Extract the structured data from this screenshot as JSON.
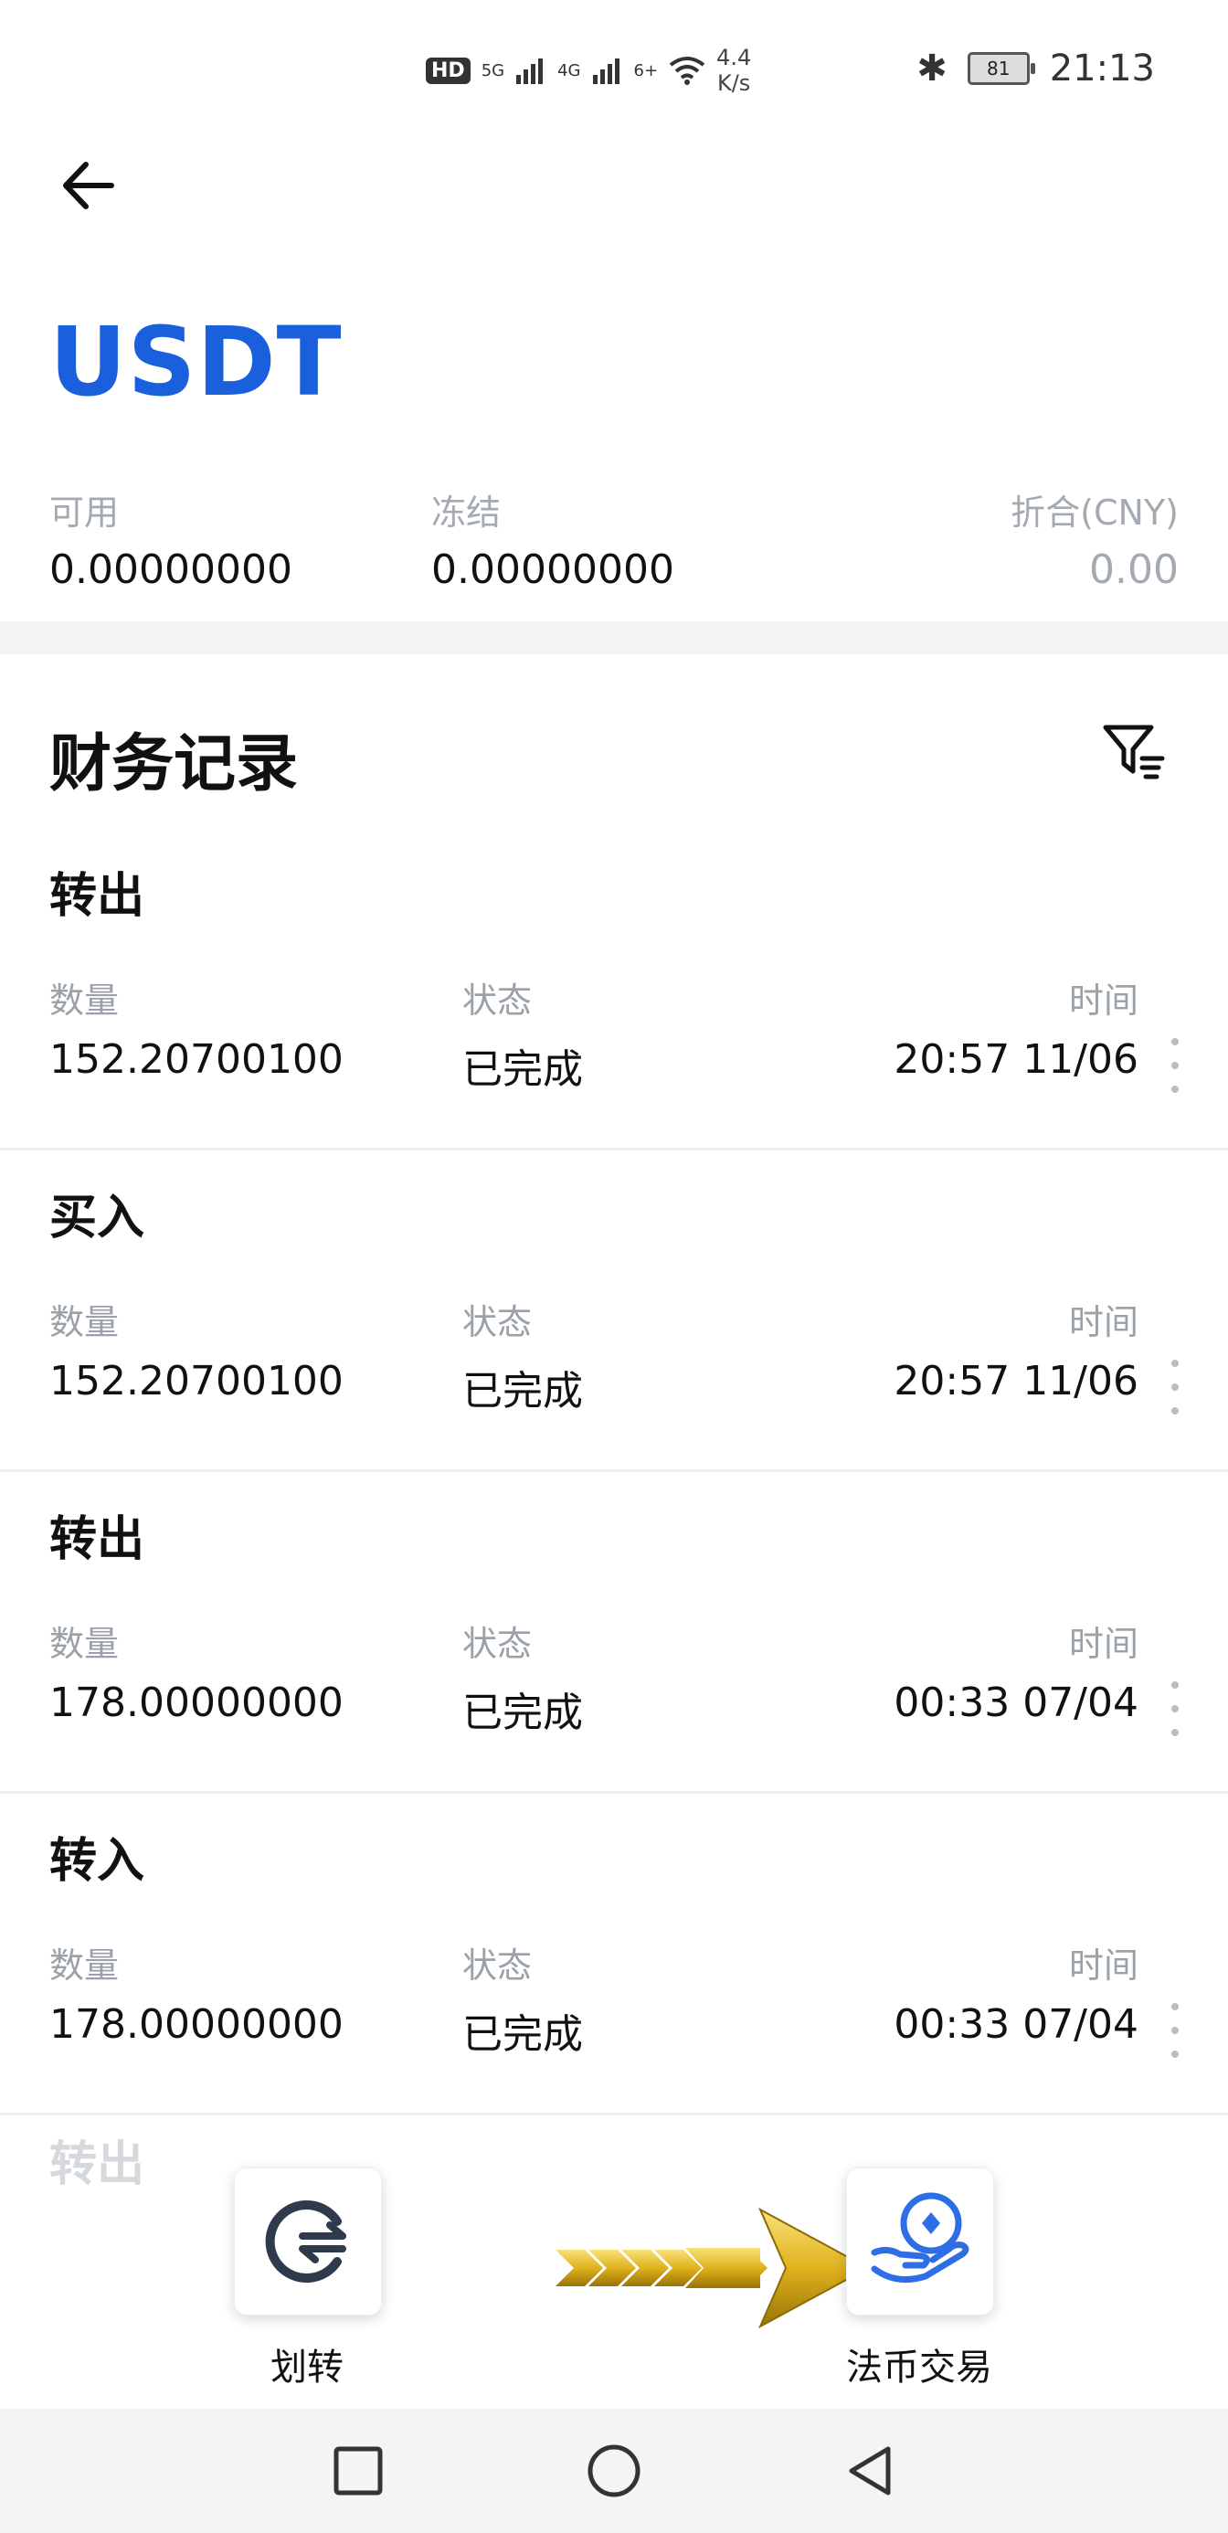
{
  "status_bar": {
    "hd": "HD",
    "sim1": "5G",
    "sim2": "4G",
    "wifi": "6+",
    "speed_value": "4.4",
    "speed_unit": "K/s",
    "battery": "81",
    "time": "21:13"
  },
  "header": {
    "title": "USDT"
  },
  "balances": {
    "available_label": "可用",
    "available_value": "0.00000000",
    "frozen_label": "冻结",
    "frozen_value": "0.00000000",
    "converted_label": "折合(CNY)",
    "converted_value": "0.00"
  },
  "records": {
    "title": "财务记录",
    "items": [
      {
        "type": "转出",
        "qty_label": "数量",
        "qty": "152.20700100",
        "status_label": "状态",
        "status": "已完成",
        "time_label": "时间",
        "time": "20:57 11/06"
      },
      {
        "type": "买入",
        "qty_label": "数量",
        "qty": "152.20700100",
        "status_label": "状态",
        "status": "已完成",
        "time_label": "时间",
        "time": "20:57 11/06"
      },
      {
        "type": "转出",
        "qty_label": "数量",
        "qty": "178.00000000",
        "status_label": "状态",
        "status": "已完成",
        "time_label": "时间",
        "time": "00:33 07/04"
      },
      {
        "type": "转入",
        "qty_label": "数量",
        "qty": "178.00000000",
        "status_label": "状态",
        "status": "已完成",
        "time_label": "时间",
        "time": "00:33 07/04"
      }
    ],
    "next_type_partial": "转出"
  },
  "actions": {
    "transfer_label": "划转",
    "fiat_label": "法币交易"
  },
  "colors": {
    "brand_blue": "#1a5fdc",
    "muted_gray": "#a4aab1",
    "arrow_gold": "#e0b21c"
  }
}
